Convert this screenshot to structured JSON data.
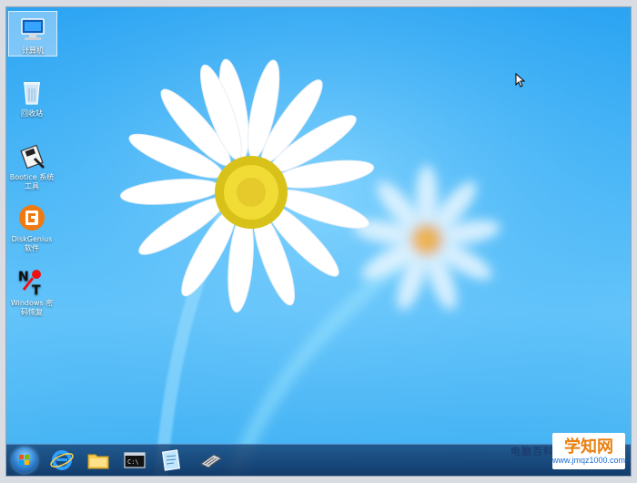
{
  "desktop": {
    "icons": [
      {
        "label": "计算机",
        "icon": "computer-icon",
        "selected": true
      },
      {
        "label": "回收站",
        "icon": "recycle-bin-icon",
        "selected": false
      },
      {
        "label": "Bootice 系统工具",
        "icon": "bootice-icon",
        "selected": false
      },
      {
        "label": "DiskGenius 软件",
        "icon": "diskgenius-icon",
        "selected": false
      },
      {
        "label": "Windows 密码恢复",
        "icon": "ntpwedit-icon",
        "selected": false
      }
    ]
  },
  "taskbar": {
    "items": [
      {
        "icon": "start-orb-icon"
      },
      {
        "icon": "internet-explorer-icon"
      },
      {
        "icon": "file-explorer-icon"
      },
      {
        "icon": "command-prompt-icon"
      },
      {
        "icon": "notepad-icon"
      },
      {
        "icon": "device-manager-icon"
      }
    ]
  },
  "watermark": {
    "title": "学知网",
    "url": "www.jmqz1000.com",
    "left_text": "电脑百科"
  },
  "colors": {
    "sky": "#3fb0f2",
    "taskbar": "#143c6e",
    "watermark_orange": "#e88010",
    "watermark_blue": "#1a6cd3"
  }
}
